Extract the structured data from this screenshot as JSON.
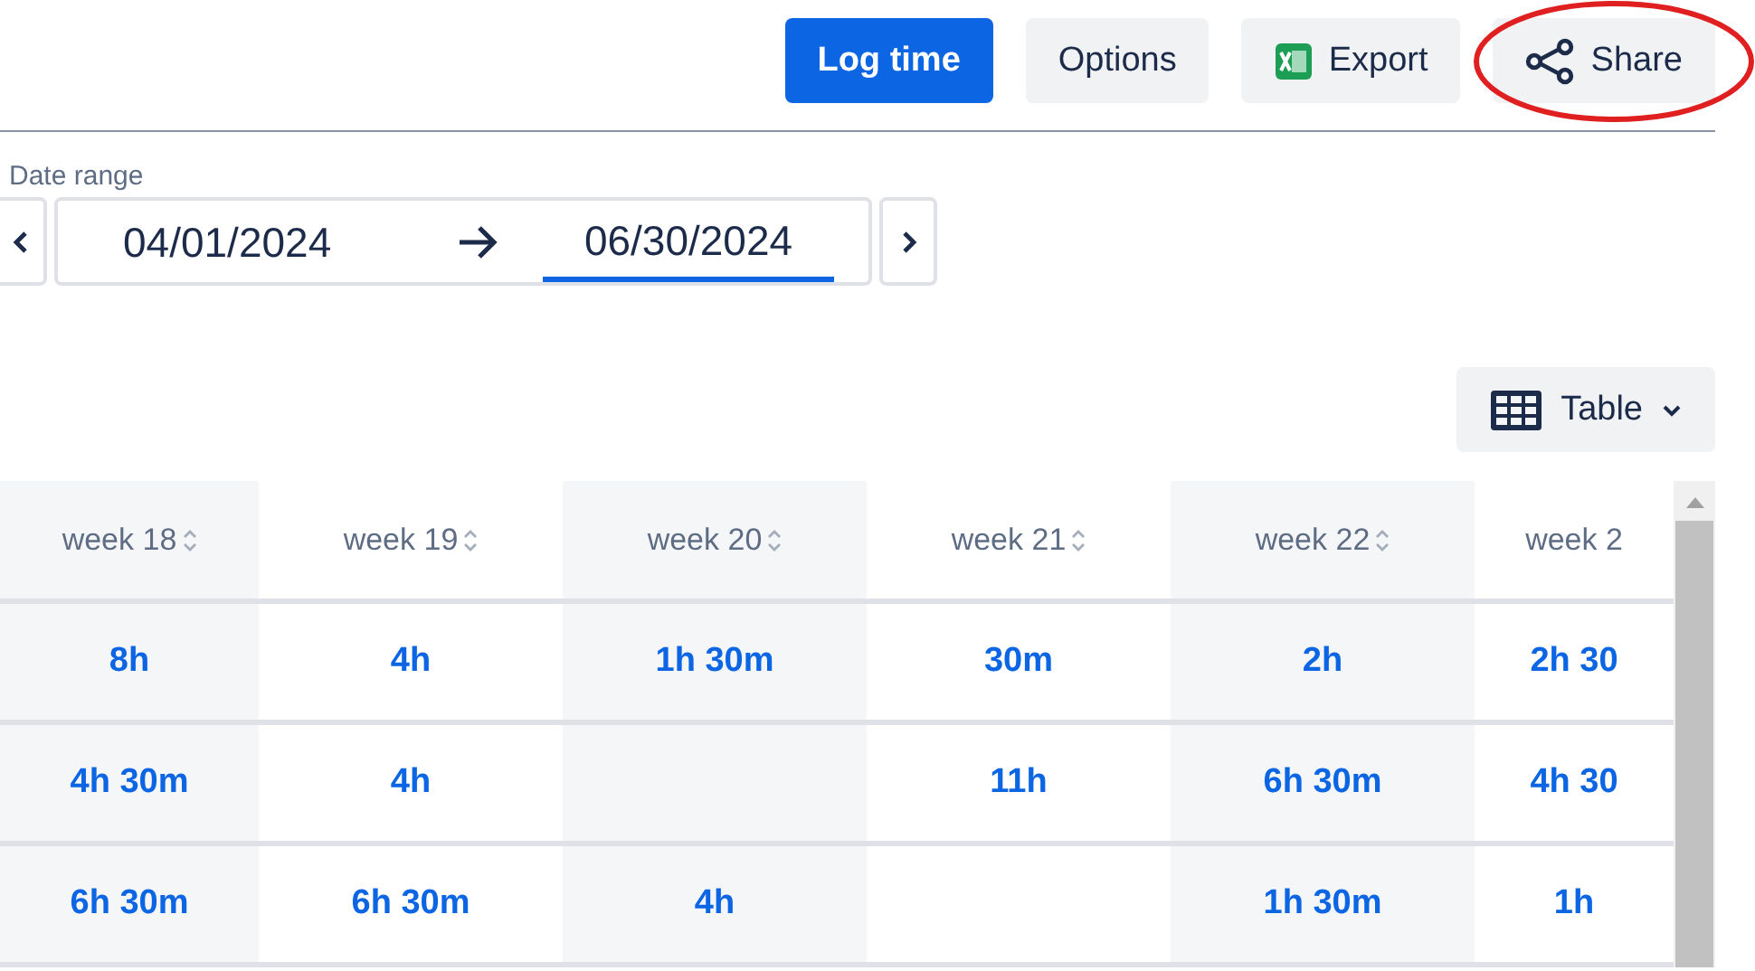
{
  "toolbar": {
    "buttons": [
      {
        "label": "Log time",
        "kind": "primary",
        "circled": false
      },
      {
        "label": "Options",
        "kind": "plain",
        "circled": false
      },
      {
        "label": "Export",
        "kind": "export",
        "circled": false
      },
      {
        "label": "Share",
        "kind": "share",
        "circled": true
      }
    ]
  },
  "date_range": {
    "label": "Date range",
    "start": "04/01/2024",
    "end": "06/30/2024",
    "end_focused": true
  },
  "view_button": {
    "label": "Table"
  },
  "table": {
    "columns": [
      "week 18",
      "week 19",
      "week 20",
      "week 21",
      "week 22",
      "week 2"
    ],
    "rows": [
      [
        "8h",
        "4h",
        "1h 30m",
        "30m",
        "2h",
        "2h 30"
      ],
      [
        "4h 30m",
        "4h",
        "",
        "11h",
        "6h 30m",
        "4h 30"
      ],
      [
        "6h 30m",
        "6h 30m",
        "4h",
        "",
        "1h 30m",
        "1h"
      ]
    ]
  }
}
